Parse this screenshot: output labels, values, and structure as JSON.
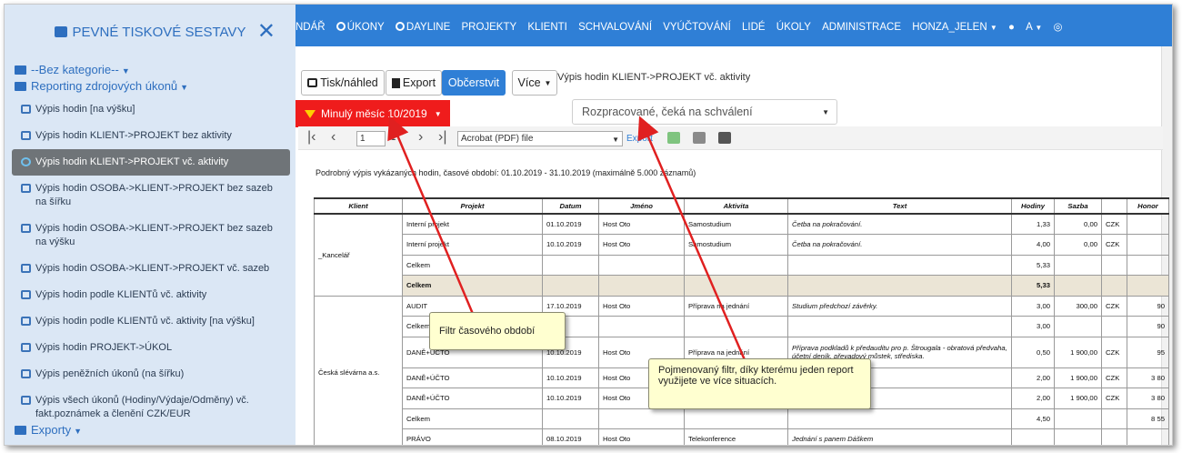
{
  "sidebar": {
    "title": "PEVNÉ TISKOVÉ SESTAVY",
    "categories": [
      "--Bez kategorie--",
      "Reporting zdrojových úkonů",
      "Exporty"
    ],
    "reports": [
      "Výpis hodin [na výšku]",
      "Výpis hodin KLIENT->PROJEKT bez aktivity",
      "Výpis hodin KLIENT->PROJEKT vč. aktivity",
      "Výpis hodin OSOBA->KLIENT->PROJEKT bez sazeb na šířku",
      "Výpis hodin OSOBA->KLIENT->PROJEKT bez sazeb na výšku",
      "Výpis hodin OSOBA->KLIENT->PROJEKT vč. sazeb",
      "Výpis hodin podle KLIENTů vč. aktivity",
      "Výpis hodin podle KLIENTů vč. aktivity [na výšku]",
      "Výpis hodin PROJEKT->ÚKOL",
      "Výpis peněžních úkonů (na šířku)",
      "Výpis všech úkonů (Hodiny/Výdaje/Odměny) vč. fakt.poznámek a členění CZK/EUR"
    ],
    "active_index": 2
  },
  "topnav": {
    "items": [
      "NDÁŘ",
      "ÚKONY",
      "DAYLINE",
      "PROJEKTY",
      "KLIENTI",
      "SCHVALOVÁNÍ",
      "VYÚČTOVÁNÍ",
      "LIDÉ",
      "ÚKOLY",
      "ADMINISTRACE",
      "HONZA_JELEN",
      "A"
    ]
  },
  "toolbar": {
    "print_label": "Tisk/náhled",
    "export_label": "Export",
    "refresh_label": "Občerstvit",
    "more_label": "Více",
    "report_title": "Výpis hodin KLIENT->PROJEKT vč. aktivity",
    "period_filter": "Minulý měsíc 10/2019",
    "state_filter": "Rozpracované, čeká na schválení"
  },
  "viewer": {
    "page": "1",
    "page_of": "1",
    "format": "Acrobat (PDF) file",
    "export_link": "Export"
  },
  "report": {
    "caption": "Podrobný výpis vykázaných hodin, časové období: 01.10.2019 - 31.10.2019 (maximálně 5.000 záznamů)",
    "columns": [
      "Klient",
      "Projekt",
      "Datum",
      "Jméno",
      "Aktivita",
      "Text",
      "Hodiny",
      "Sazba",
      "",
      "Honor"
    ],
    "rows": [
      [
        "",
        "Interní projekt",
        "01.10.2019",
        "Host Oto",
        "Samostudium",
        "Četba na pokračování.",
        "1,33",
        "0,00",
        "CZK",
        ""
      ],
      [
        "_Kancelář",
        "Interní projekt",
        "10.10.2019",
        "Host Oto",
        "Samostudium",
        "Četba na pokračování.",
        "4,00",
        "0,00",
        "CZK",
        ""
      ],
      [
        "",
        "Celkem",
        "",
        "",
        "",
        "",
        "5,33",
        "",
        "",
        ""
      ],
      [
        "",
        "Celkem",
        "",
        "",
        "",
        "",
        "5,33",
        "",
        "",
        ""
      ],
      [
        "",
        "AUDIT",
        "17.10.2019",
        "Host Oto",
        "Příprava na jednání",
        "Studium předchozí závěrky.",
        "3,00",
        "300,00",
        "CZK",
        "90"
      ],
      [
        "",
        "Celkem",
        "",
        "",
        "",
        "",
        "3,00",
        "",
        "",
        "90"
      ],
      [
        "",
        "DANĚ+ÚČTO",
        "10.10.2019",
        "Host Oto",
        "Příprava na jednání",
        "Příprava podkladů k předauditu pro p. Štrougala - obratová předvaha, účetní deník, převadový můstek, střediska.",
        "0,50",
        "1 900,00",
        "CZK",
        "95"
      ],
      [
        "Česká slévárna a.s.",
        "DANĚ+ÚČTO",
        "10.10.2019",
        "Host Oto",
        "",
        "",
        "2,00",
        "1 900,00",
        "CZK",
        "3 80"
      ],
      [
        "",
        "DANĚ+ÚČTO",
        "10.10.2019",
        "Host Oto",
        "",
        "",
        "2,00",
        "1 900,00",
        "CZK",
        "3 80"
      ],
      [
        "",
        "Celkem",
        "",
        "",
        "",
        "",
        "4,50",
        "",
        "",
        "8 55"
      ],
      [
        "",
        "PRÁVO",
        "08.10.2019",
        "Host Oto",
        "Telekonference",
        "Jednání s panem Dáškem",
        "",
        "",
        "",
        ""
      ]
    ]
  },
  "callouts": {
    "period": "Filtr časového období",
    "named": "Pojmenovaný filtr, díky kterému jeden report využijete ve více situacích."
  },
  "colors": {
    "accent": "#2f7fd6",
    "filter": "#ef1c1c",
    "sidebar_bg": "#dbe7f5",
    "total_row": "#ebe5d6",
    "callout_bg": "#ffffd0",
    "arrow": "#e02020"
  }
}
